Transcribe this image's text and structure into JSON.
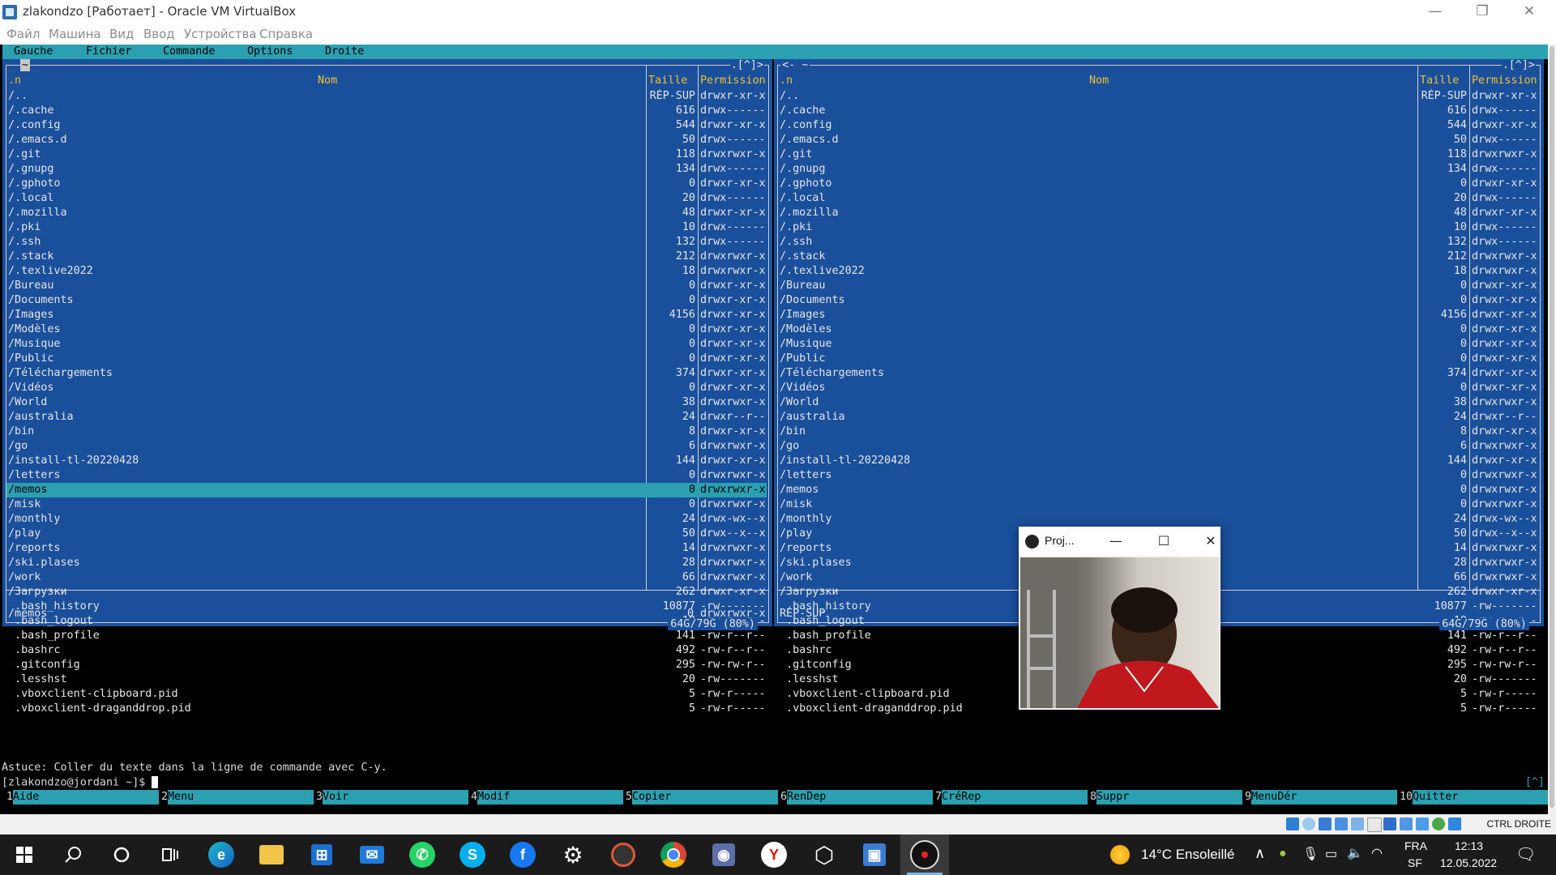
{
  "window": {
    "title": "zlakondzo [Работает] - Oracle VM VirtualBox",
    "menu": [
      "Файл",
      "Машина",
      "Вид",
      "Ввод",
      "Устройства",
      "Справка"
    ]
  },
  "mc": {
    "menu": [
      "Gauche",
      "Fichier",
      "Commande",
      "Options",
      "Droite"
    ],
    "left": {
      "path": "~",
      "top_right": ".[^]>",
      "header": {
        "n": ".n",
        "name": "Nom",
        "size": "Taille",
        "perm": "Permission"
      },
      "selected_index": 27,
      "status_name": "/memos",
      "status_size": "0",
      "status_perm": "drwxrwxr-x",
      "free": "64G/79G (80%)"
    },
    "right": {
      "path": "<- ~",
      "top_right": ".[^]>",
      "header": {
        "n": ".n",
        "name": "Nom",
        "size": "Taille",
        "perm": "Permission"
      },
      "status_name": "RÉP-SUP",
      "free": "64G/79G (80%)"
    },
    "files": [
      {
        "name": "/..",
        "size": "RÉP-SUP",
        "perm": "drwxr-xr-x"
      },
      {
        "name": "/.cache",
        "size": "616",
        "perm": "drwx------"
      },
      {
        "name": "/.config",
        "size": "544",
        "perm": "drwxr-xr-x"
      },
      {
        "name": "/.emacs.d",
        "size": "50",
        "perm": "drwx------"
      },
      {
        "name": "/.git",
        "size": "118",
        "perm": "drwxrwxr-x"
      },
      {
        "name": "/.gnupg",
        "size": "134",
        "perm": "drwx------"
      },
      {
        "name": "/.gphoto",
        "size": "0",
        "perm": "drwxr-xr-x"
      },
      {
        "name": "/.local",
        "size": "20",
        "perm": "drwx------"
      },
      {
        "name": "/.mozilla",
        "size": "48",
        "perm": "drwxr-xr-x"
      },
      {
        "name": "/.pki",
        "size": "10",
        "perm": "drwx------"
      },
      {
        "name": "/.ssh",
        "size": "132",
        "perm": "drwx------"
      },
      {
        "name": "/.stack",
        "size": "212",
        "perm": "drwxrwxr-x"
      },
      {
        "name": "/.texlive2022",
        "size": "18",
        "perm": "drwxrwxr-x"
      },
      {
        "name": "/Bureau",
        "size": "0",
        "perm": "drwxr-xr-x"
      },
      {
        "name": "/Documents",
        "size": "0",
        "perm": "drwxr-xr-x"
      },
      {
        "name": "/Images",
        "size": "4156",
        "perm": "drwxr-xr-x"
      },
      {
        "name": "/Modèles",
        "size": "0",
        "perm": "drwxr-xr-x"
      },
      {
        "name": "/Musique",
        "size": "0",
        "perm": "drwxr-xr-x"
      },
      {
        "name": "/Public",
        "size": "0",
        "perm": "drwxr-xr-x"
      },
      {
        "name": "/Téléchargements",
        "size": "374",
        "perm": "drwxr-xr-x"
      },
      {
        "name": "/Vidéos",
        "size": "0",
        "perm": "drwxr-xr-x"
      },
      {
        "name": "/World",
        "size": "38",
        "perm": "drwxrwxr-x"
      },
      {
        "name": "/australia",
        "size": "24",
        "perm": "drwxr--r--"
      },
      {
        "name": "/bin",
        "size": "8",
        "perm": "drwxr-xr-x"
      },
      {
        "name": "/go",
        "size": "6",
        "perm": "drwxrwxr-x"
      },
      {
        "name": "/install-tl-20220428",
        "size": "144",
        "perm": "drwxr-xr-x"
      },
      {
        "name": "/letters",
        "size": "0",
        "perm": "drwxrwxr-x"
      },
      {
        "name": "/memos",
        "size": "0",
        "perm": "drwxrwxr-x"
      },
      {
        "name": "/misk",
        "size": "0",
        "perm": "drwxrwxr-x"
      },
      {
        "name": "/monthly",
        "size": "24",
        "perm": "drwx-wx--x"
      },
      {
        "name": "/play",
        "size": "50",
        "perm": "drwx--x--x"
      },
      {
        "name": "/reports",
        "size": "14",
        "perm": "drwxrwxr-x"
      },
      {
        "name": "/ski.plases",
        "size": "28",
        "perm": "drwxrwxr-x"
      },
      {
        "name": "/work",
        "size": "66",
        "perm": "drwxrwxr-x"
      },
      {
        "name": "/Загрузки",
        "size": "262",
        "perm": "drwxr-xr-x"
      },
      {
        "name": " .bash_history",
        "size": "10877",
        "perm": "-rw-------"
      },
      {
        "name": " .bash_logout",
        "size": "18",
        "perm": "-rw-r--r--"
      },
      {
        "name": " .bash_profile",
        "size": "141",
        "perm": "-rw-r--r--"
      },
      {
        "name": " .bashrc",
        "size": "492",
        "perm": "-rw-r--r--"
      },
      {
        "name": " .gitconfig",
        "size": "295",
        "perm": "-rw-rw-r--"
      },
      {
        "name": " .lesshst",
        "size": "20",
        "perm": "-rw-------"
      },
      {
        "name": " .vboxclient-clipboard.pid",
        "size": "5",
        "perm": "-rw-r-----"
      },
      {
        "name": " .vboxclient-draganddrop.pid",
        "size": "5",
        "perm": "-rw-r-----"
      }
    ],
    "hint": "Astuce: Coller du texte dans la ligne de commande avec C-y.",
    "prompt": "[zlakondzo@jordani ~]$ ",
    "history_button": "[^]",
    "fkeys": [
      {
        "num": "1",
        "label": "Aide"
      },
      {
        "num": "2",
        "label": "Menu"
      },
      {
        "num": "3",
        "label": "Voir"
      },
      {
        "num": "4",
        "label": "Modif"
      },
      {
        "num": "5",
        "label": "Copier"
      },
      {
        "num": "6",
        "label": "RenDep"
      },
      {
        "num": "7",
        "label": "CréRep"
      },
      {
        "num": "8",
        "label": "Suppr"
      },
      {
        "num": "9",
        "label": "MenuDér"
      },
      {
        "num": "10",
        "label": "Quitter"
      }
    ]
  },
  "camera_window": {
    "title": "Proj..."
  },
  "vb_status": {
    "host_key": "CTRL DROITE"
  },
  "taskbar": {
    "weather": "14°C Ensoleillé",
    "lang_top": "FRA",
    "lang_bottom": "SF",
    "time": "12:13",
    "date": "12.05.2022"
  }
}
